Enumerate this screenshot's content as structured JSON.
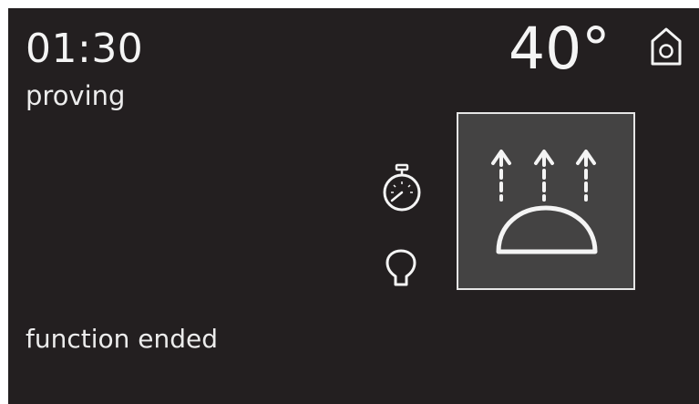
{
  "display": {
    "time": "01:30",
    "mode_label": "proving",
    "temperature": "40°",
    "status_message": "function ended"
  },
  "icons": {
    "home": "home-icon",
    "timer": "stopwatch-icon",
    "light": "oven-light-icon",
    "function": "proving-function-icon"
  },
  "colors": {
    "background": "#231f20",
    "text": "#f4f4f4",
    "tile": "#444343",
    "tile_border": "#e6e6e6"
  }
}
